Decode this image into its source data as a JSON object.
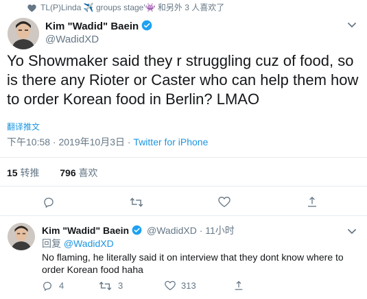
{
  "social_context": {
    "text": "TL(P)Linda ✈️ groups stage'👾 和另外 3 人喜欢了"
  },
  "main_tweet": {
    "display_name": "Kim \"Wadid\" Baein",
    "handle": "@WadidXD",
    "text": "Yo Showmaker said they r struggling cuz of food, so is there any Rioter or Caster who can help them how to order Korean food in Berlin? LMAO",
    "translate_label": "翻译推文",
    "timestamp": "下午10:58 · 2019年10月3日 · ",
    "source": "Twitter for iPhone",
    "retweets": {
      "count": "15",
      "label": "转推"
    },
    "likes": {
      "count": "796",
      "label": "喜欢"
    }
  },
  "reply_tweet": {
    "display_name": "Kim \"Wadid\" Baein",
    "handle_time": "@WadidXD · 11小时",
    "reply_to_prefix": "回复 ",
    "reply_to_handle": "@WadidXD",
    "text": "No flaming, he literally said it on interview that they dont know where to order Korean food haha",
    "reply_count": "4",
    "retweet_count": "3",
    "like_count": "313"
  },
  "colors": {
    "accent": "#1b95e0",
    "muted": "#657786",
    "text": "#14171a",
    "divider": "#e6ecf0",
    "verified": "#1da1f2"
  },
  "icons": [
    "heart-icon",
    "more-icon",
    "verified-icon",
    "reply-icon",
    "retweet-icon",
    "like-icon",
    "share-icon"
  ]
}
